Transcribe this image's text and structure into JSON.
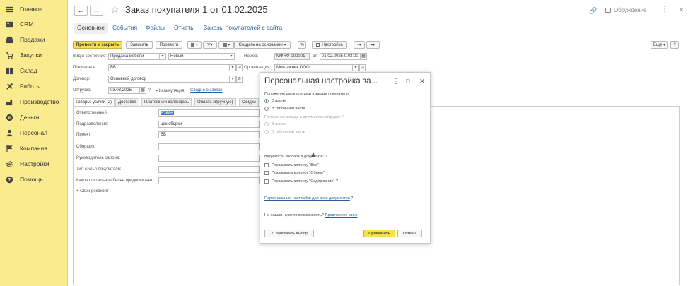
{
  "sidebar": {
    "items": [
      {
        "label": "Главное",
        "icon": "menu-icon"
      },
      {
        "label": "CRM",
        "icon": "crm-icon"
      },
      {
        "label": "Продажи",
        "icon": "sales-icon"
      },
      {
        "label": "Закупки",
        "icon": "purchases-icon"
      },
      {
        "label": "Склад",
        "icon": "warehouse-icon"
      },
      {
        "label": "Работы",
        "icon": "tools-icon"
      },
      {
        "label": "Производство",
        "icon": "production-icon"
      },
      {
        "label": "Деньги",
        "icon": "money-icon"
      },
      {
        "label": "Персонал",
        "icon": "person-icon"
      },
      {
        "label": "Компания",
        "icon": "flag-icon"
      },
      {
        "label": "Настройки",
        "icon": "gear-icon"
      },
      {
        "label": "Помощь",
        "icon": "help-icon"
      }
    ]
  },
  "header": {
    "back": "←",
    "forward": "→",
    "star": "☆",
    "title": "Заказ покупателя 1 от 01.02.2025",
    "link_icon": "🔗",
    "discussion": "Обсуждение",
    "more": "⋮",
    "maximize": "□",
    "close": "✕"
  },
  "tabs": [
    "Основное",
    "События",
    "Файлы",
    "Отчеты",
    "Заказы покупателей с сайта"
  ],
  "toolbar": {
    "post_close": "Провести и закрыть",
    "save": "Записать",
    "post": "Провести",
    "create_based": "Создать на основании",
    "percent": "%",
    "settings": "Настройка",
    "more": "Еще"
  },
  "form": {
    "op_label": "Вид и состояние:",
    "op_value": "Продажа мебели",
    "state_value": "Новый",
    "number_label": "Номер:",
    "number_value": "МФНФ-000001",
    "date_label": "от:",
    "date_value": "01.02.2025  0:03:00",
    "customer_label": "Покупатель:",
    "customer_value": "ВБ",
    "org_label": "Организация:",
    "org_value": "Монтажник ООО",
    "contract_label": "Договор:",
    "contract_value": "Основной договор",
    "ship_label": "Отгрузка:",
    "ship_value": "03.03.2025",
    "ship_q": "?",
    "calc_label": "Калькуляция",
    "calc_link": "Сводно о заказе"
  },
  "inner_tabs": [
    "Товары, услуги (2)",
    "Доставка",
    "Платежный календарь",
    "Оплата (Вручную)",
    "Скидки"
  ],
  "details": {
    "rows": [
      {
        "label": "Ответственный:",
        "value": "Рзван"
      },
      {
        "label": "Подразделение:",
        "value": "цех сборки"
      },
      {
        "label": "Проект:",
        "value": "ВБ"
      },
      {
        "label": "Сборщик:",
        "value": ""
      },
      {
        "label": "Руководитель салона:",
        "value": ""
      },
      {
        "label": "Тип жилья покупателя:",
        "value": ""
      },
      {
        "label": "Какое постельное белье предпочитает:",
        "value": ""
      }
    ],
    "own_attr": "+ Свой реквизит"
  },
  "dialog": {
    "title": "Персональная настройка за...",
    "q1": "Положение даты отгрузки в заказе покупателя:",
    "q1_opt1": "В шапке",
    "q1_opt2": "В табличной части",
    "q2": "Положение склада в документах отгрузки:",
    "q2_mark": "?",
    "q2_opt1": "В шапке",
    "q2_opt2": "В табличной части",
    "q3": "Видимость колонок в документе:",
    "q3_mark": "?",
    "cb1": "Показывать колонку \"Вес\"",
    "cb2": "Показывать колонку \"Объем\"",
    "cb3": "Показывать колонку \"Содержание\"",
    "cb3_mark": "?",
    "personal_link": "Персональные настройки для всех документов",
    "personal_mark": "?",
    "not_found": "Не нашли нужную возможность?",
    "suggest_link": "Предложите свою",
    "remember": "Запомнить выбор",
    "apply": "Применить",
    "cancel": "Отмена",
    "more": "⋮",
    "maximize": "□",
    "close": "✕"
  },
  "colors": {
    "sidebar": "#fbeb8f",
    "primary_button": "#f6e04e",
    "link": "#2a5d9e"
  }
}
